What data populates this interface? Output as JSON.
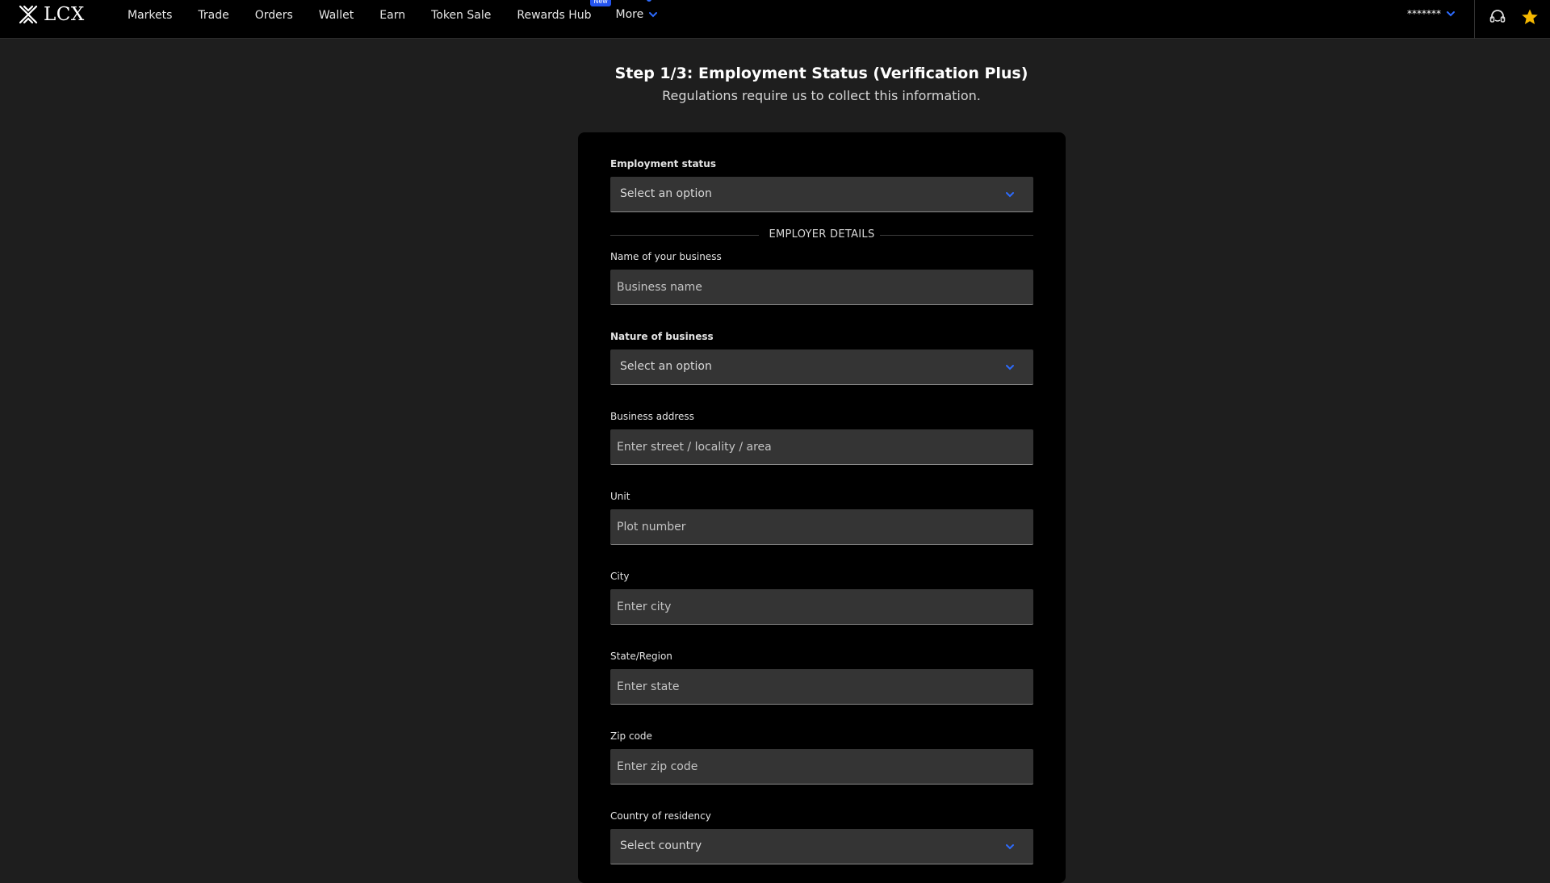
{
  "header": {
    "logo_text": "LCX",
    "nav": [
      {
        "label": "Markets"
      },
      {
        "label": "Trade"
      },
      {
        "label": "Orders"
      },
      {
        "label": "Wallet"
      },
      {
        "label": "Earn"
      },
      {
        "label": "Token Sale"
      },
      {
        "label": "Rewards Hub",
        "badge": "New"
      },
      {
        "label": "More"
      }
    ],
    "user_masked": "*******",
    "icons": [
      "x-logo-icon",
      "chevron-down-icon",
      "headset-support-icon",
      "star-icon"
    ],
    "accent_color": "#2d6bff",
    "star_color": "#f5b800"
  },
  "page": {
    "title": "Step 1/3: Employment Status (Verification Plus)",
    "subtitle": "Regulations require us to collect this information."
  },
  "form": {
    "employment_status": {
      "label": "Employment status",
      "value": "Select an option"
    },
    "section_title": "EMPLOYER DETAILS",
    "business_name": {
      "label": "Name of your business",
      "placeholder": "Business name"
    },
    "nature_of_business": {
      "label": "Nature of business",
      "value": "Select an option"
    },
    "business_address": {
      "label": "Business address",
      "placeholder": "Enter street / locality / area"
    },
    "unit": {
      "label": "Unit",
      "placeholder": "Plot number"
    },
    "city": {
      "label": "City",
      "placeholder": "Enter city"
    },
    "state": {
      "label": "State/Region",
      "placeholder": "Enter state"
    },
    "zip": {
      "label": "Zip code",
      "placeholder": "Enter zip code"
    },
    "country": {
      "label": "Country of residency",
      "value": "Select country"
    }
  }
}
